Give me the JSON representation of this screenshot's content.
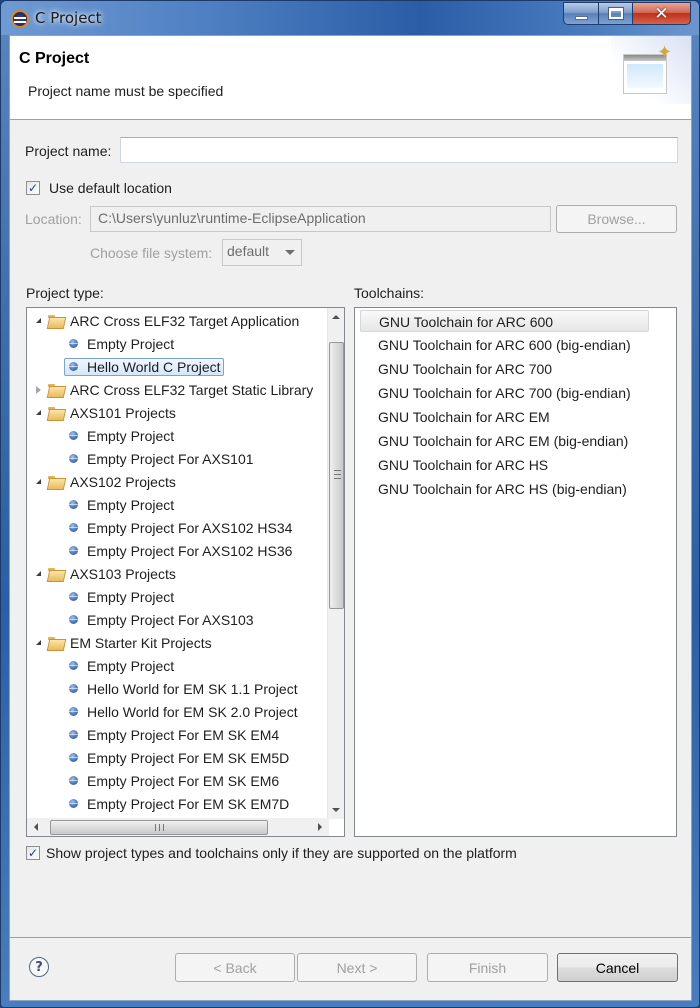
{
  "window": {
    "title": "C Project",
    "controls": [
      "minimize",
      "maximize",
      "close"
    ]
  },
  "header": {
    "title": "C Project",
    "message": "Project name must be specified"
  },
  "form": {
    "project_name_label": "Project name:",
    "project_name_value": "",
    "use_default_location_label": "Use default location",
    "use_default_location_checked": true,
    "location_label": "Location:",
    "location_value": "C:\\Users\\yunluz\\runtime-EclipseApplication",
    "browse_label": "Browse...",
    "file_system_label": "Choose file system:",
    "file_system_value": "default"
  },
  "project_type": {
    "label": "Project type:",
    "items": [
      {
        "level": 0,
        "type": "folder",
        "expanded": true,
        "label": "ARC Cross ELF32 Target Application"
      },
      {
        "level": 1,
        "type": "leaf",
        "label": "Empty Project"
      },
      {
        "level": 1,
        "type": "leaf",
        "label": "Hello World C Project",
        "selected": true
      },
      {
        "level": 0,
        "type": "folder",
        "expanded": false,
        "label": "ARC Cross ELF32 Target Static Library"
      },
      {
        "level": 0,
        "type": "folder",
        "expanded": true,
        "label": "AXS101 Projects"
      },
      {
        "level": 1,
        "type": "leaf",
        "label": "Empty Project"
      },
      {
        "level": 1,
        "type": "leaf",
        "label": "Empty Project For AXS101"
      },
      {
        "level": 0,
        "type": "folder",
        "expanded": true,
        "label": "AXS102 Projects"
      },
      {
        "level": 1,
        "type": "leaf",
        "label": "Empty Project"
      },
      {
        "level": 1,
        "type": "leaf",
        "label": "Empty Project For AXS102 HS34"
      },
      {
        "level": 1,
        "type": "leaf",
        "label": "Empty Project For AXS102 HS36"
      },
      {
        "level": 0,
        "type": "folder",
        "expanded": true,
        "label": "AXS103 Projects"
      },
      {
        "level": 1,
        "type": "leaf",
        "label": "Empty Project"
      },
      {
        "level": 1,
        "type": "leaf",
        "label": "Empty Project For AXS103"
      },
      {
        "level": 0,
        "type": "folder",
        "expanded": true,
        "label": "EM Starter Kit Projects"
      },
      {
        "level": 1,
        "type": "leaf",
        "label": "Empty Project"
      },
      {
        "level": 1,
        "type": "leaf",
        "label": "Hello World for EM SK 1.1 Project"
      },
      {
        "level": 1,
        "type": "leaf",
        "label": "Hello World for EM SK 2.0 Project"
      },
      {
        "level": 1,
        "type": "leaf",
        "label": "Empty Project For EM SK EM4"
      },
      {
        "level": 1,
        "type": "leaf",
        "label": "Empty Project For EM SK EM5D"
      },
      {
        "level": 1,
        "type": "leaf",
        "label": "Empty Project For EM SK EM6"
      },
      {
        "level": 1,
        "type": "leaf",
        "label": "Empty Project For EM SK EM7D"
      }
    ]
  },
  "toolchains": {
    "label": "Toolchains:",
    "items": [
      {
        "label": "GNU Toolchain for ARC 600",
        "selected": true
      },
      {
        "label": "GNU Toolchain for ARC 600 (big-endian)"
      },
      {
        "label": "GNU Toolchain for ARC 700"
      },
      {
        "label": "GNU Toolchain for ARC 700 (big-endian)"
      },
      {
        "label": "GNU Toolchain for ARC EM"
      },
      {
        "label": "GNU Toolchain for ARC EM (big-endian)"
      },
      {
        "label": "GNU Toolchain for ARC HS"
      },
      {
        "label": "GNU Toolchain for ARC HS (big-endian)"
      }
    ]
  },
  "show_supported": {
    "label": "Show project types and toolchains only if they are supported on the platform",
    "checked": true
  },
  "footer": {
    "help_glyph": "?",
    "back_label": "< Back",
    "next_label": "Next >",
    "finish_label": "Finish",
    "cancel_label": "Cancel"
  },
  "colors": {
    "selection_border": "#7da2ce",
    "title_bar": "#2a5da6",
    "close_button": "#c0301a"
  }
}
